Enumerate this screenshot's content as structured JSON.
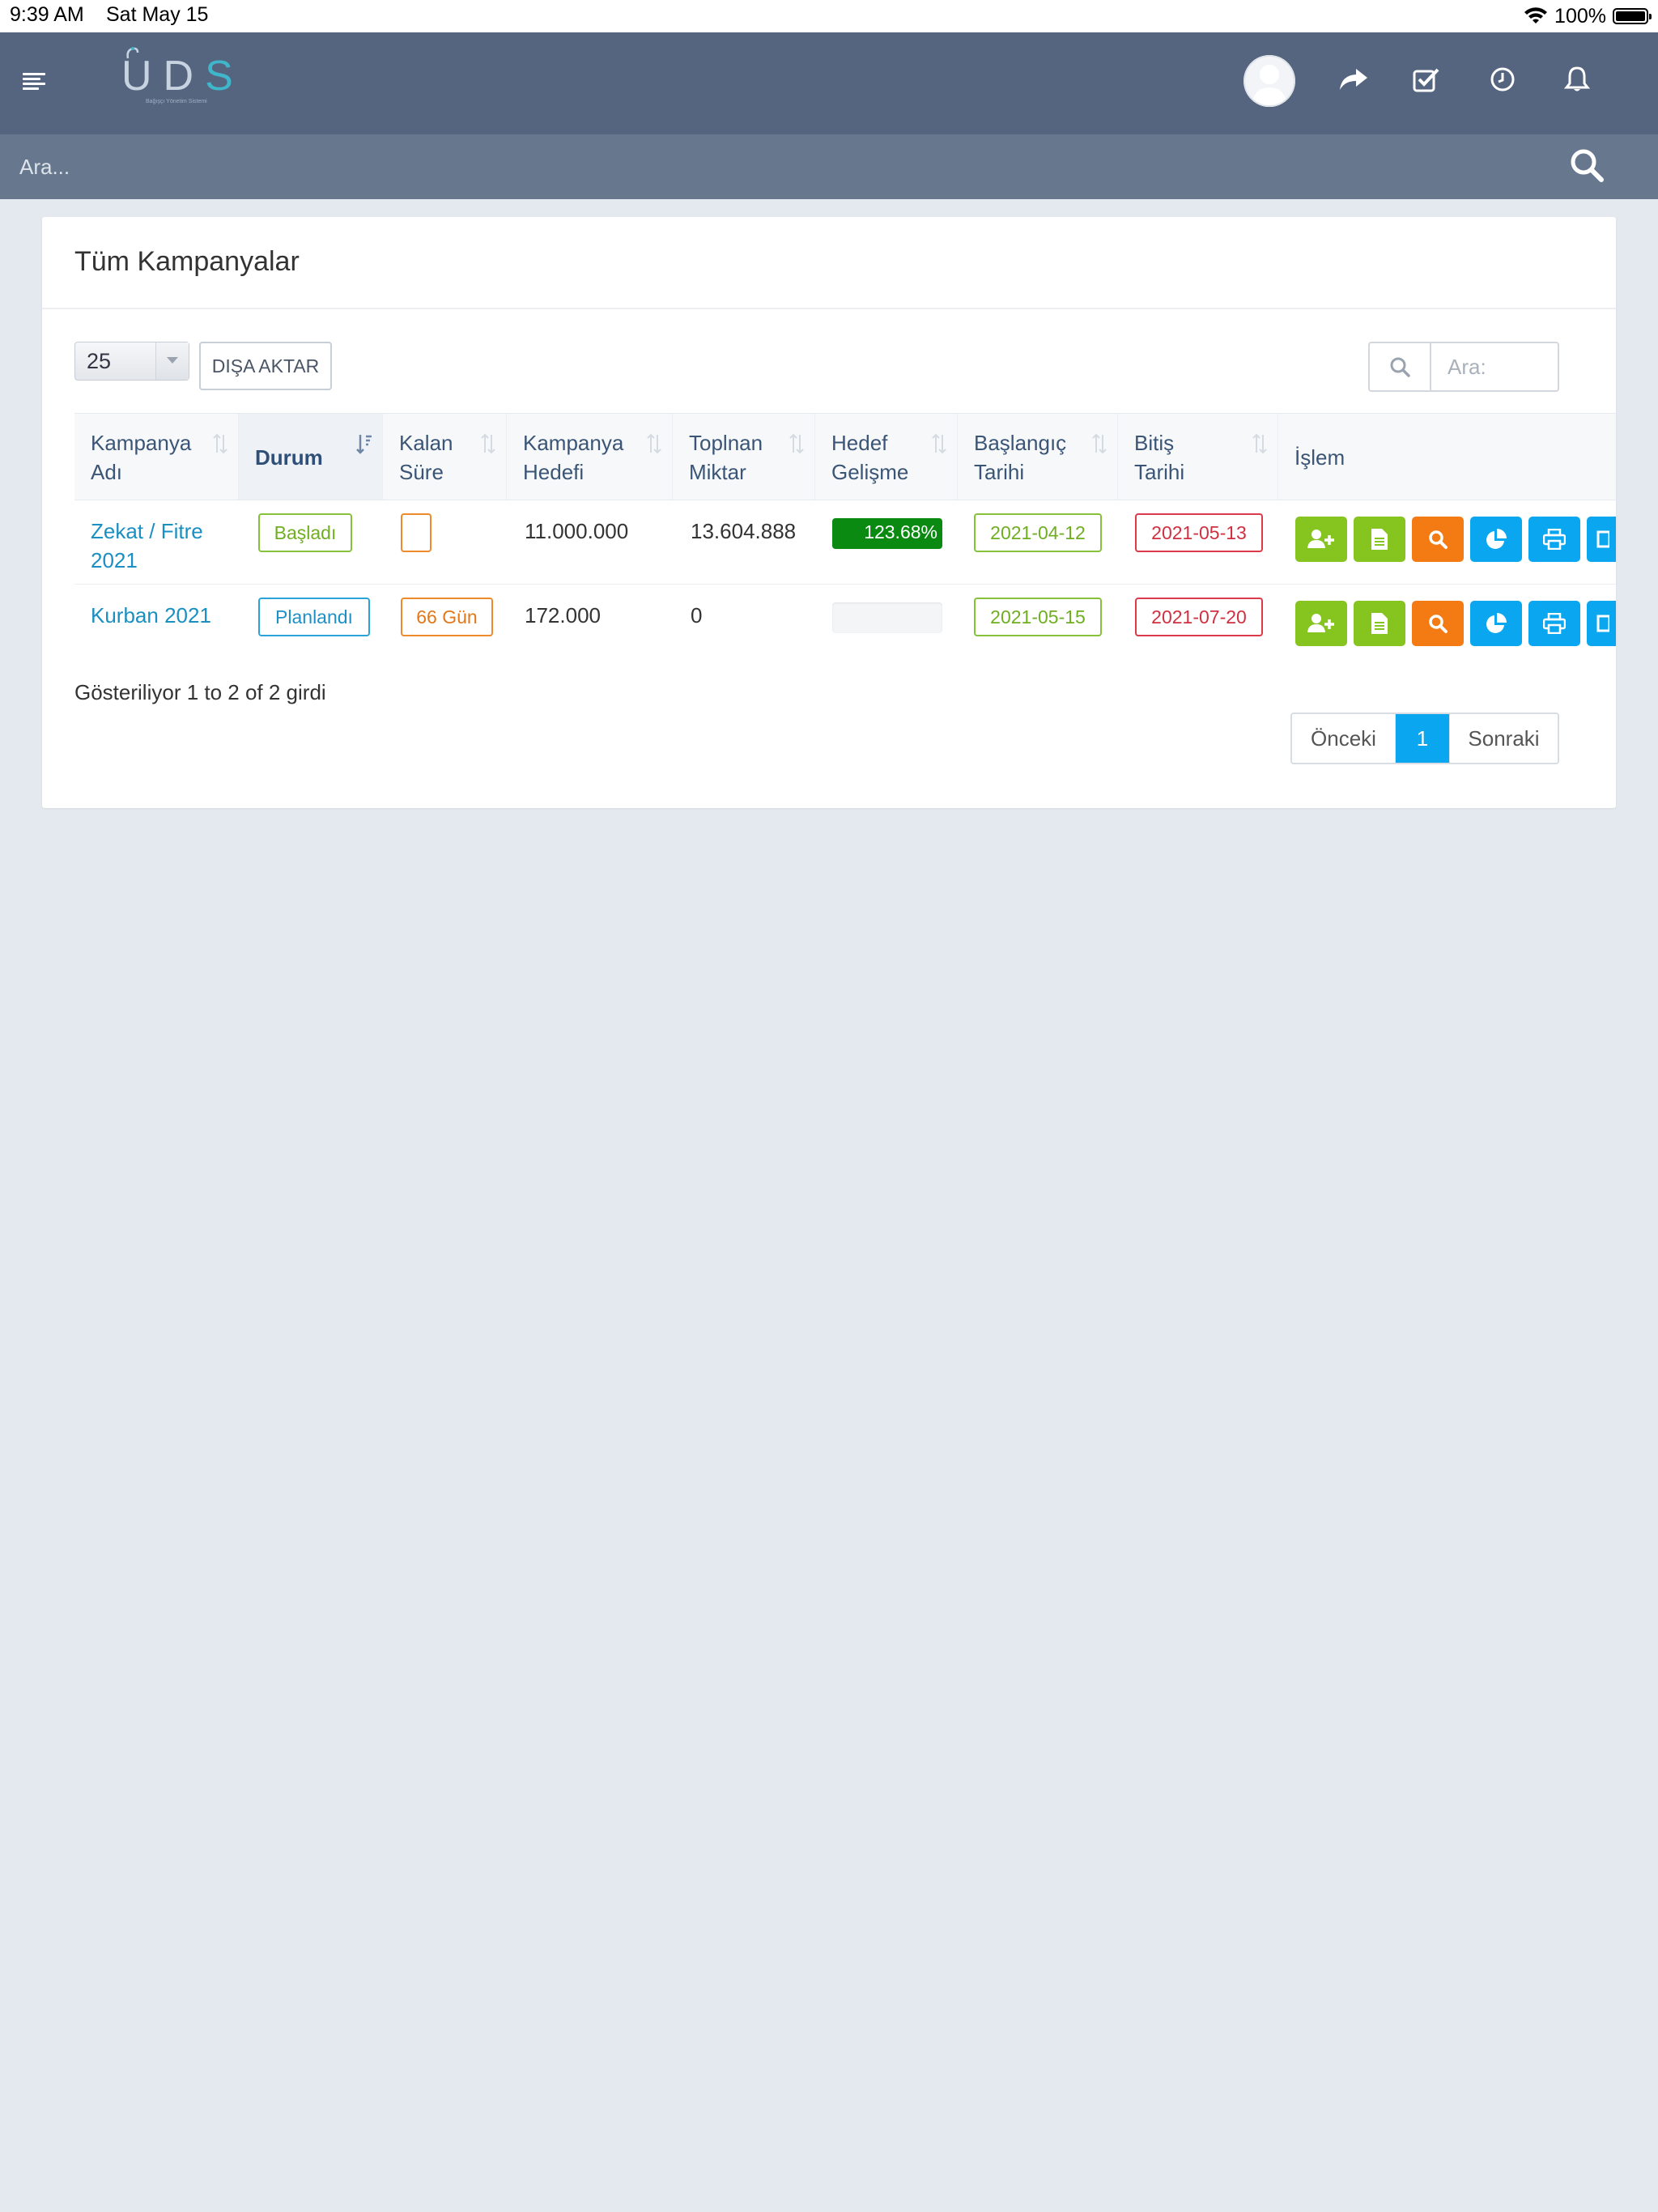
{
  "status_bar": {
    "time": "9:39 AM",
    "date": "Sat May 15",
    "battery": "100%"
  },
  "header": {
    "logo_main": "UD",
    "logo_accent": "S",
    "logo_sub": "Bağışçı Yönetim Sistemi",
    "icons": [
      "menu-icon",
      "avatar",
      "share-icon",
      "task-check-icon",
      "clock-icon",
      "bell-icon"
    ]
  },
  "search": {
    "placeholder": "Ara..."
  },
  "card": {
    "title": "Tüm Kampanyalar",
    "page_length": "25",
    "export_label": "DIŞA AKTAR",
    "table_search_placeholder": "Ara:",
    "columns": [
      {
        "line1": "Kampanya",
        "line2": "Adı"
      },
      {
        "line1": "Durum",
        "line2": ""
      },
      {
        "line1": "Kalan",
        "line2": "Süre"
      },
      {
        "line1": "Kampanya",
        "line2": "Hedefi"
      },
      {
        "line1": "Toplnan",
        "line2": "Miktar"
      },
      {
        "line1": "Hedef",
        "line2": "Gelişme"
      },
      {
        "line1": "Başlangıç",
        "line2": "Tarihi"
      },
      {
        "line1": "Bitiş",
        "line2": "Tarihi"
      },
      {
        "line1": "İşlem",
        "line2": ""
      }
    ],
    "rows": [
      {
        "name_line1": "Zekat / Fitre",
        "name_line2": "2021",
        "status": "Başladı",
        "remaining": "",
        "target": "11.000.000",
        "collected": "13.604.888",
        "progress_label": "123.68%",
        "progress_fraction": 1.0,
        "start": "2021-04-12",
        "end": "2021-05-13"
      },
      {
        "name_line1": "Kurban 2021",
        "name_line2": "",
        "status": "Planlandı",
        "remaining": "66 Gün",
        "target": "172.000",
        "collected": "0",
        "progress_label": "",
        "progress_fraction": 0.0,
        "start": "2021-05-15",
        "end": "2021-07-20"
      }
    ],
    "info": "Gösteriliyor 1 to 2 of 2 girdi",
    "pagination": {
      "prev": "Önceki",
      "current": "1",
      "next": "Sonraki"
    }
  },
  "colors": {
    "header": "#55657f",
    "search_bar": "#67778e",
    "green": "#86c41f",
    "orange": "#f47a14",
    "blue": "#0aa6ef",
    "progress": "#0b8a12"
  }
}
